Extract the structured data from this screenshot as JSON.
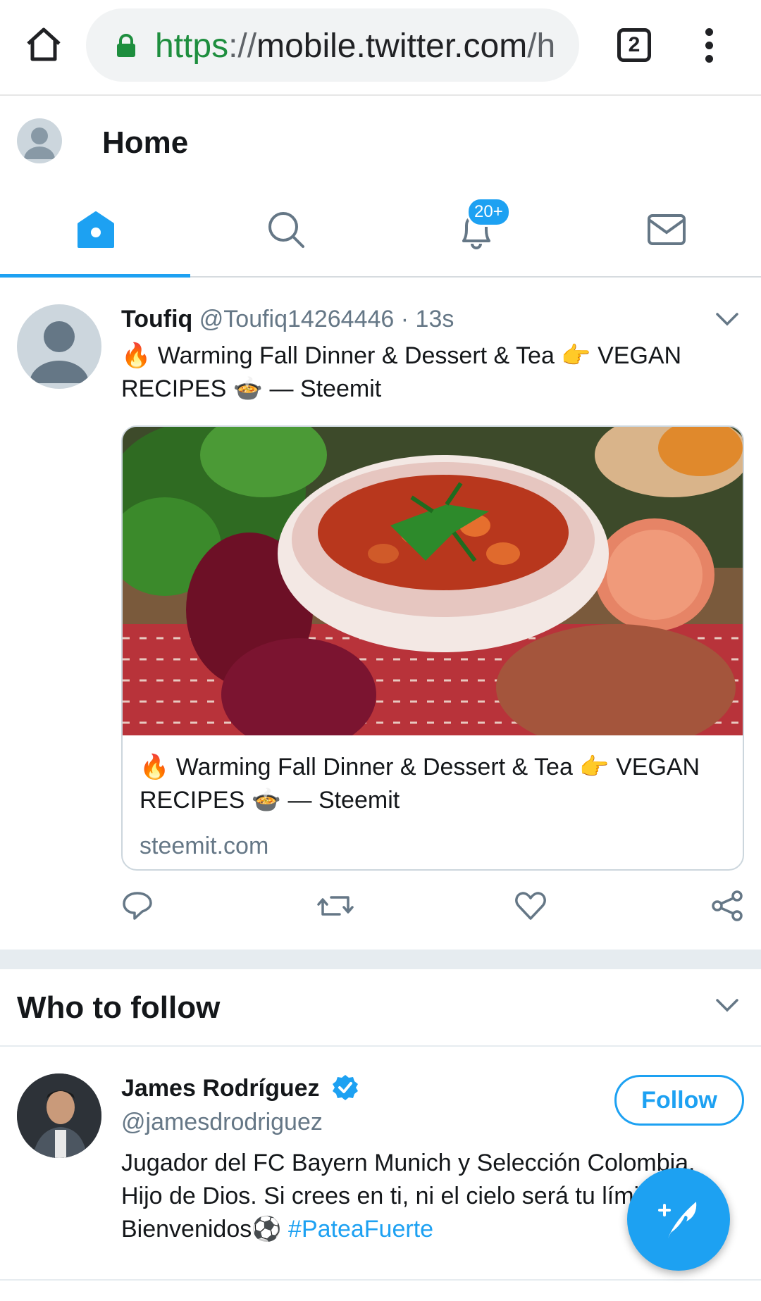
{
  "browser": {
    "url_scheme": "https",
    "url_sep": "://",
    "url_host": "mobile.twitter.com",
    "url_rest": "/h",
    "tab_count": "2"
  },
  "header": {
    "title": "Home"
  },
  "nav": {
    "notifications_badge": "20+",
    "accent": "#1da1f2"
  },
  "tweet": {
    "name": "Toufiq",
    "handle": "@Toufiq14264446",
    "sep": "·",
    "time": "13s",
    "text": "🔥 Warming Fall Dinner &  Dessert & Tea 👉 VEGAN RECIPES 🍲 — Steemit",
    "card": {
      "title": "🔥 Warming Fall Dinner & Dessert & Tea 👉 VEGAN RECIPES 🍲 — Steemit",
      "domain": "steemit.com"
    }
  },
  "who_to_follow": {
    "title": "Who to follow",
    "user": {
      "name": "James Rodríguez",
      "handle": "@jamesdrodriguez",
      "bio_line1": "Jugador del FC Bayern Munich y Selección Colombia.",
      "bio_line2": "Hijo de Dios. Si crees en ti, ni el cielo será tu límite!",
      "bio_line3": "Bienvenidos⚽ ",
      "bio_hashtag": "#PateaFuerte",
      "follow_label": "Follow"
    }
  }
}
